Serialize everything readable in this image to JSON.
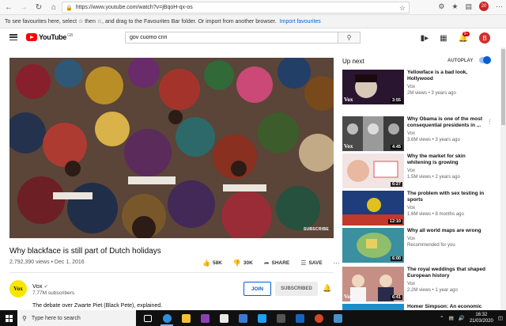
{
  "browser": {
    "url": "https://www.youtube.com/watch?v=jBqoH-qx-os",
    "fav_bar_text": "To see favourites here, select ☆ then ☆, and drag to the Favourites Bar folder. Or import from another browser.",
    "fav_bar_link": "Import favourites",
    "profile_badge": "20"
  },
  "youtube": {
    "logo_text": "YouTube",
    "logo_region": "GB",
    "search_value": "gov cuomo cnn",
    "notif_count": "9+",
    "avatar_letter": "B"
  },
  "video": {
    "title": "Why blackface is still part of Dutch holidays",
    "meta": "2,792,390 views • Dec 1, 2016",
    "likes": "58K",
    "dislikes": "30K",
    "share_label": "SHARE",
    "save_label": "SAVE",
    "watermark": "SUBSCRIBE",
    "channel": "Vox",
    "channel_subs": "7.77M subscribers",
    "channel_avatar_text": "Vox",
    "join_label": "JOIN",
    "subscribed_label": "SUBSCRIBED",
    "description": "The debate over Zwarte Piet (Black Pete), explained."
  },
  "sidebar": {
    "up_next": "Up next",
    "autoplay": "AUTOPLAY",
    "autoplay_on": true,
    "items": [
      {
        "title": "Yellowface is a bad look, Hollywood",
        "channel": "Vox",
        "views": "2M views • 3 years ago",
        "duration": "3:55",
        "color": "#2a1530"
      },
      {
        "title": "Why Obama is one of the most consequential presidents in ...",
        "channel": "Vox",
        "views": "3.6M views • 3 years ago",
        "duration": "4:45",
        "color": "#3c3c3c"
      },
      {
        "title": "Why the market for skin whitening is growing",
        "channel": "Vox",
        "views": "1.5M views • 2 years ago",
        "duration": "6:27",
        "color": "#e9c9c9"
      },
      {
        "title": "The problem with sex testing in sports",
        "channel": "Vox",
        "views": "1.6M views • 8 months ago",
        "duration": "12:10",
        "color": "#1f3d7a"
      },
      {
        "title": "Why all world maps are wrong",
        "channel": "Vox",
        "views": "Recommended for you",
        "duration": "6:00",
        "color": "#3a8fa0"
      },
      {
        "title": "The royal weddings that shaped European history",
        "channel": "Vox",
        "views": "2.2M views • 1 year ago",
        "duration": "6:41",
        "color": "#c58f86"
      },
      {
        "title": "Homer Simpson: An economic",
        "channel": "",
        "views": "",
        "duration": "",
        "color": "#1b8fc9"
      }
    ]
  },
  "taskbar": {
    "search_placeholder": "Type here to search",
    "time": "16:32",
    "date": "21/03/2020"
  }
}
